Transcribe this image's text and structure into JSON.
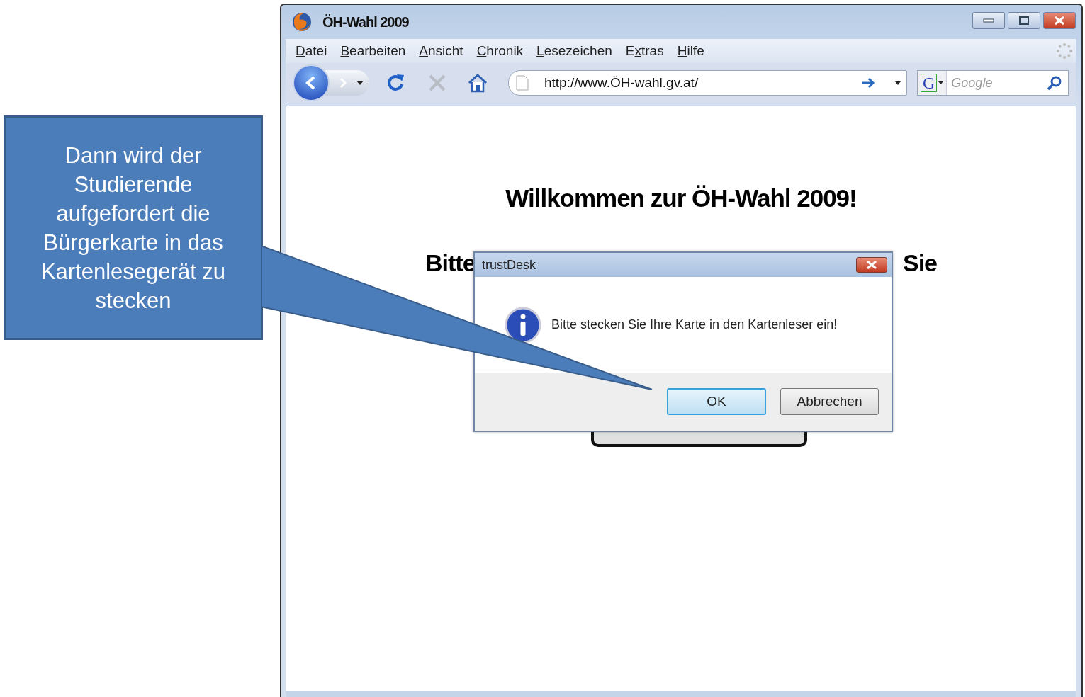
{
  "callout": {
    "text": "Dann wird der Studierende aufgefordert die Bürgerkarte in das Kartenlesegerät zu stecken"
  },
  "window": {
    "title": "ÖH-Wahl 2009"
  },
  "menu": [
    {
      "key": "D",
      "after": "atei"
    },
    {
      "key": "B",
      "after": "earbeiten"
    },
    {
      "key": "A",
      "after": "nsicht"
    },
    {
      "key": "C",
      "after": "hronik"
    },
    {
      "key": "L",
      "after": "esezeichen"
    },
    {
      "before": "E",
      "key": "x",
      "after": "tras"
    },
    {
      "key": "H",
      "after": "ilfe"
    }
  ],
  "toolbar": {
    "stop_disabled": true,
    "url": "http://www.ÖH-wahl.gv.at/",
    "engine": "G",
    "search_placeholder": "Google"
  },
  "page": {
    "heading": "Willkommen zur ÖH-Wahl 2009!",
    "prompt_left": "Bitte",
    "prompt_right": "Sie"
  },
  "dialog": {
    "title": "trustDesk",
    "message": "Bitte stecken Sie Ihre Karte in den Kartenleser ein!",
    "buttons": [
      {
        "label": "OK",
        "default": true
      },
      {
        "label": "Abbrechen",
        "default": false
      }
    ]
  }
}
